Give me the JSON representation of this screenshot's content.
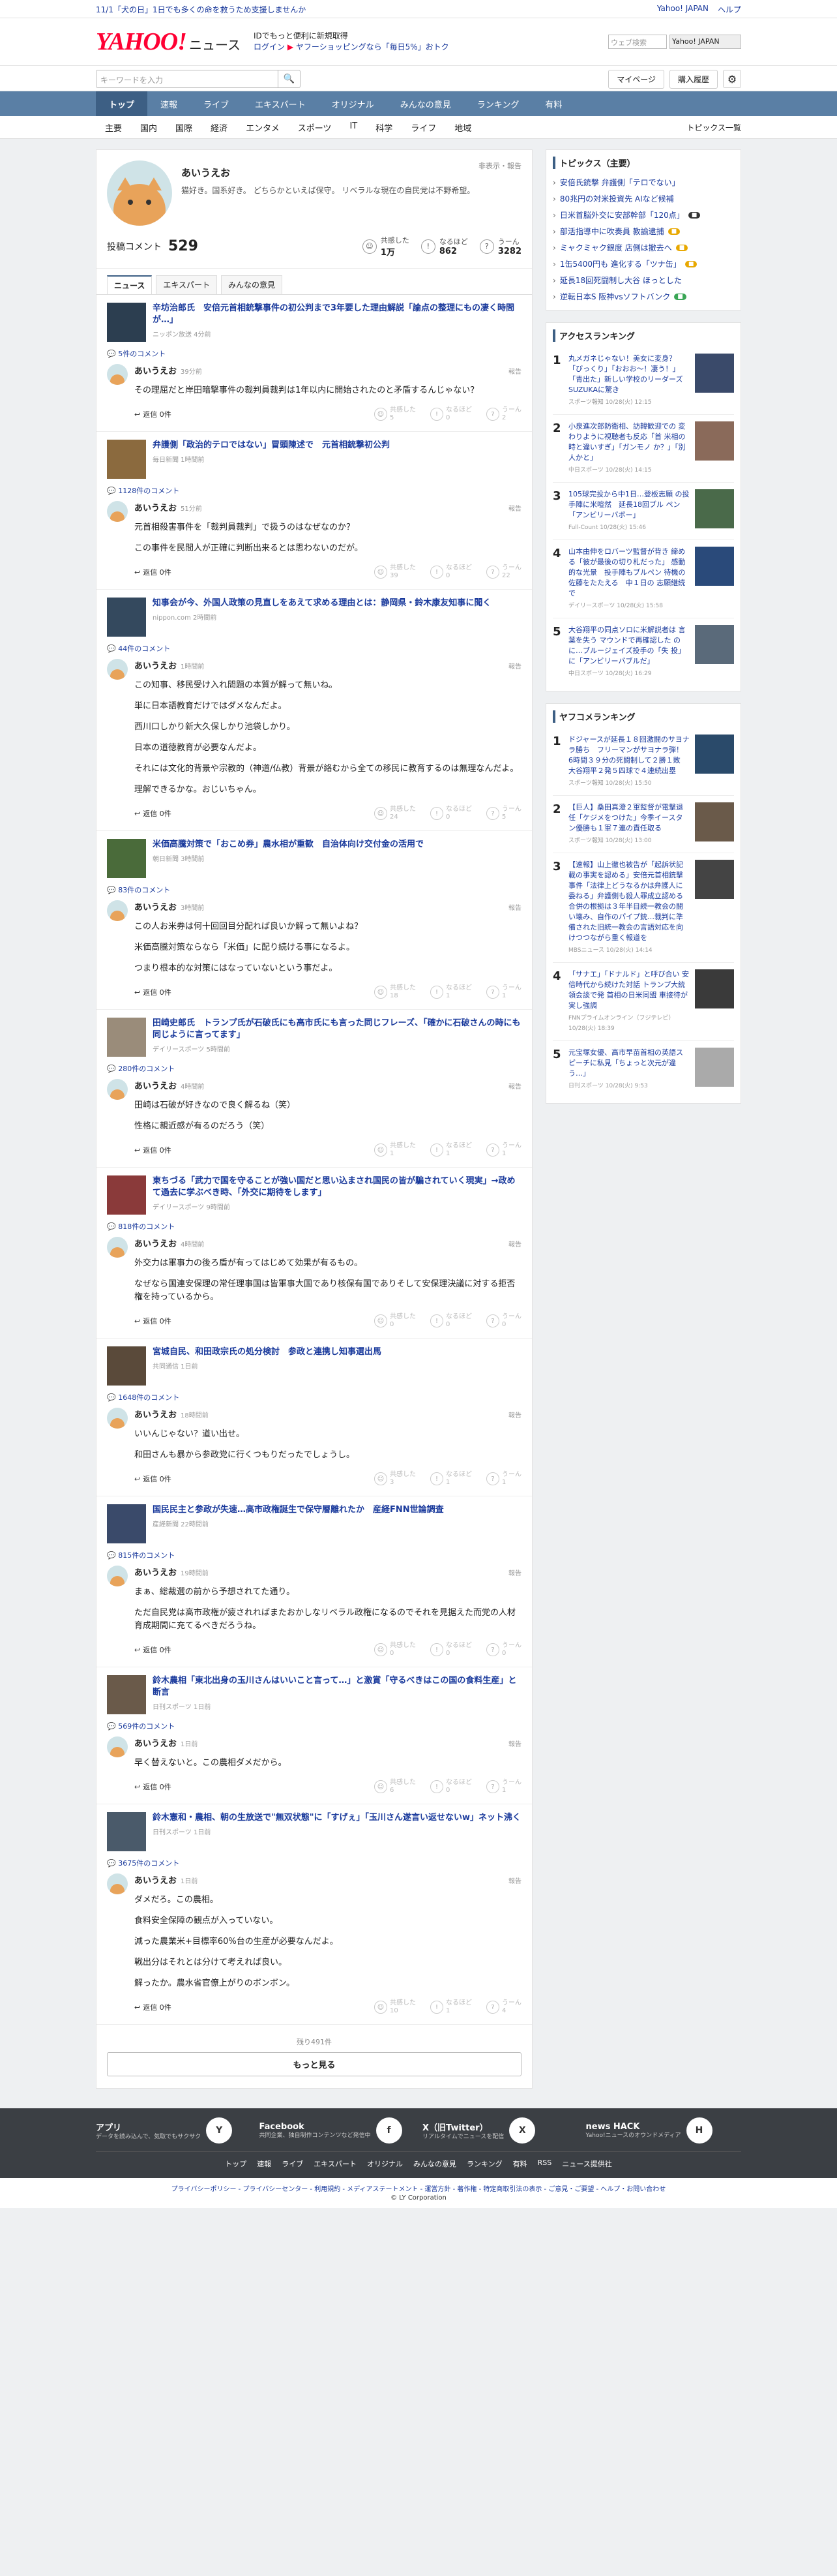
{
  "topbar": {
    "promo": "11/1「犬の日」1日でも多くの命を救うため支援しませんか",
    "links": [
      "Yahoo! JAPAN",
      "ヘルプ"
    ],
    "search_placeholder": "ウェブ検索",
    "yahoo_label": "Yahoo! JAPAN"
  },
  "header": {
    "logo": "YAHOO!",
    "logo_sub": "ニュース",
    "promo_line1": "IDでもっと便利に新規取得",
    "promo_login": "ログイン",
    "promo_line2": "ヤフーショッピングなら「毎日5%」おトク"
  },
  "searchbar": {
    "placeholder": "キーワードを入力",
    "mypage": "マイページ",
    "history": "購入履歴"
  },
  "nav1": [
    "トップ",
    "速報",
    "ライブ",
    "エキスパート",
    "オリジナル",
    "みんなの意見",
    "ランキング",
    "有料"
  ],
  "nav2": {
    "items": [
      "主要",
      "国内",
      "国際",
      "経済",
      "エンタメ",
      "スポーツ",
      "IT",
      "科学",
      "ライフ",
      "地域"
    ],
    "right": "トピックス一覧"
  },
  "profile": {
    "name": "あいうえお",
    "bio": "猫好き。国系好き。 どちらかといえば保守。 リベラルな現在の自民党は不野希望。",
    "report": "非表示・報告",
    "comment_label": "投稿コメント",
    "comment_count": "529",
    "reactions": [
      {
        "label": "共感した",
        "value": "1万"
      },
      {
        "label": "なるほど",
        "value": "862"
      },
      {
        "label": "うーん",
        "value": "3282"
      }
    ]
  },
  "tabs": [
    "ニュース",
    "エキスパート",
    "みんなの意見"
  ],
  "entries": [
    {
      "title": "辛坊治郎氏　安倍元首相銃撃事件の初公判まで3年要した理由解説「論点の整理にもの凄く時間が…」",
      "source": "ニッポン放送 4分前",
      "ccount": "5件のコメント",
      "time": "39分前",
      "paras": [
        "その理屈だと岸田暗撃事件の裁判員裁判は1年以内に開始されたのと矛盾するんじゃない？"
      ],
      "r": [
        "5",
        "0",
        "2"
      ]
    },
    {
      "title": "弁護側「政治的テロではない」冒頭陳述で　元首相銃撃初公判",
      "source": "毎日新聞 1時間前",
      "ccount": "1128件のコメント",
      "time": "51分前",
      "paras": [
        "元首相殺害事件を「裁判員裁判」で扱うのはなぜなのか？",
        "この事件を民間人が正確に判断出来るとは思わないのだが。"
      ],
      "r": [
        "39",
        "0",
        "22"
      ]
    },
    {
      "title": "知事会が今、外国人政策の見直しをあえて求める理由とは：静岡県・鈴木康友知事に聞く",
      "source": "nippon.com 2時間前",
      "ccount": "44件のコメント",
      "time": "1時間前",
      "paras": [
        "この知事、移民受け入れ問題の本質が解って無いね。",
        "単に日本語教育だけではダメなんだよ。",
        "西川口しかり新大久保しかり池袋しかり。",
        "日本の道徳教育が必要なんだよ。",
        "それには文化的背景や宗教的（神道/仏教）背景が絡むから全ての移民に教育するのは無理なんだよ。",
        "理解できるかな。おじいちゃん。"
      ],
      "r": [
        "24",
        "0",
        "5"
      ]
    },
    {
      "title": "米価高騰対策で「おこめ券」農水相が重歓　自治体向け交付金の活用で",
      "source": "朝日新聞 3時間前",
      "ccount": "83件のコメント",
      "time": "3時間前",
      "paras": [
        "この人お米券は何十回回目分配れば良いか解って無いよね？",
        "米価高騰対策ならなら「米価」に配り続ける事になるよ。",
        "つまり根本的な対策にはなっていないという事だよ。"
      ],
      "r": [
        "18",
        "1",
        "1"
      ]
    },
    {
      "title": "田崎史郎氏　トランプ氏が石破氏にも高市氏にも言った同じフレーズ、「確かに石破さんの時にも同じように言ってます」",
      "source": "デイリースポーツ 5時間前",
      "ccount": "280件のコメント",
      "time": "4時間前",
      "paras": [
        "田崎は石破が好きなので良く解るね（笑）",
        "性格に親近感が有るのだろう（笑）"
      ],
      "r": [
        "1",
        "1",
        "1"
      ]
    },
    {
      "title": "東ちづる「武力で国を守ることが強い国だと思い込まされ国民の皆が騙されていく現実」→政めて過去に学ぶべき時、「外交に期待をします」",
      "source": "デイリースポーツ 9時間前",
      "ccount": "818件のコメント",
      "time": "4時間前",
      "paras": [
        "外交力は軍事力の後ろ盾が有ってはじめて効果が有るもの。",
        "なぜなら国連安保理の常任理事国は皆軍事大国であり核保有国でありそして安保理決議に対する拒否権を持っているから。"
      ],
      "r": [
        "0",
        "0",
        "0"
      ]
    },
    {
      "title": "宮城自民、和田政宗氏の処分検討　参政と連携し知事選出馬",
      "source": "共同通信 1日前",
      "ccount": "1648件のコメント",
      "time": "18時間前",
      "paras": [
        "いいんじゃない？道い出せ。",
        "和田さんも暴から参政党に行くつもりだったでしょうし。"
      ],
      "r": [
        "3",
        "1",
        "1"
      ]
    },
    {
      "title": "国民民主と参政が失速…高市政権誕生で保守層離れたか　産経FNN世論調査",
      "source": "産経新聞 22時間前",
      "ccount": "815件のコメント",
      "time": "19時間前",
      "paras": [
        "まぁ、総裁選の前から予想されてた通り。",
        "ただ自民党は高市政権が疲されればまたおかしなリベラル政権になるのでそれを見据えた而党の人材育成期間に充てるべきだろうね。"
      ],
      "r": [
        "0",
        "0",
        "0"
      ]
    },
    {
      "title": "鈴木農相「東北出身の玉川さんはいいこと言って…」と激賞「守るべきはこの国の食料生産」と断言",
      "source": "日刊スポーツ 1日前",
      "ccount": "569件のコメント",
      "time": "1日前",
      "paras": [
        "早く替えないと。この農相ダメだから。"
      ],
      "r": [
        "6",
        "0",
        "1"
      ]
    },
    {
      "title": "鈴木憲和・農相、朝の生放送で\"無双状態\"に「すげぇ」「玉川さん遂言い返せないw」ネット沸く",
      "source": "日刊スポーツ 1日前",
      "ccount": "3675件のコメント",
      "time": "1日前",
      "paras": [
        "ダメだろ。この農相。",
        "食料安全保障の観点が入っていない。",
        "減った農業米+目標率60%台の生産が必要なんだよ。",
        "戦出分はそれとは分けて考えれば良い。",
        "解ったか。農水省官僚上がりのボンボン。"
      ],
      "r": [
        "10",
        "1",
        "4"
      ]
    }
  ],
  "comment_name": "あいうえお",
  "comment_report": "報告",
  "reply_label": "返信 0件",
  "react_labels": [
    "共感した",
    "なるほど",
    "うーん"
  ],
  "more": {
    "rest": "残り491件",
    "button": "もっと見る"
  },
  "topics": {
    "heading": "トピックス（主要）",
    "items": [
      {
        "t": "安倍氏銃撃 弁護側「テロでない」",
        "b": ""
      },
      {
        "t": "80兆円の対米投資先 AIなど候補",
        "b": ""
      },
      {
        "t": "日米首脳外交に安部幹部「120点」",
        "b": "icon"
      },
      {
        "t": "部活指導中に吹奏員 教諭逮捕",
        "b": "new"
      },
      {
        "t": "ミャクミャク銀度 店側は撤去へ",
        "b": "new"
      },
      {
        "t": "1缶5400円も 進化する「ツナ缶」",
        "b": "new"
      },
      {
        "t": "延長18回死闘制し大谷 ほっとした",
        "b": ""
      },
      {
        "t": "逆転日本S 阪神vsソフトバンク",
        "b": "live"
      }
    ],
    "badge_colors": {
      "new": "#e8a800",
      "live": "#3aa655",
      "icon": "#333333"
    }
  },
  "access": {
    "heading": "アクセスランキング",
    "items": [
      {
        "n": "1",
        "t": "丸メガネじゃない！美女に変身？「びっくり」「おおお～！凄う！」「青出た」新しい学校のリーダーズSUZUKAに驚き",
        "s": "スポーツ報知 10/28(火) 12:15"
      },
      {
        "n": "2",
        "t": "小泉進次郎防衛相、訪韓歓迎での 変わりように視聴者も反応「首 米相の時と違いすぎ」「ガンモノ か？」「別人かと」",
        "s": "中日スポーツ 10/28(火) 14:15"
      },
      {
        "n": "3",
        "t": "105球完投から中1日…登板志願 の投手陣に米喧然　延長18回ブル ペン「アンビリーバボー」",
        "s": "Full-Count 10/28(火) 15:46"
      },
      {
        "n": "4",
        "t": "山本由伸をロバーツ監督が背き 締める「彼が最後の切り札だった」 感動的な光景　投手陣もブルペン 待機の佐藤をたたえる　中１日の 志願継続で",
        "s": "デイリースポーツ 10/28(火) 15:58"
      },
      {
        "n": "5",
        "t": "大谷翔平の同点ソロに米解説者は 言葉を失う マウンドで再確認した のに…ブルージェイズ投手の「失 投」に「アンビリーバブルだ」",
        "s": "中日スポーツ 10/28(火) 16:29"
      }
    ]
  },
  "yafuko": {
    "heading": "ヤフコメランキング",
    "items": [
      {
        "n": "1",
        "t": "ドジャースが延長１８回激闘のサヨナラ勝ち　フリーマンがサヨナラ弾！　6時間３９分の死闘制して２勝１敗　大谷翔平２発５四球で４連続出塁",
        "s": "スポーツ報知 10/28(火) 15:50"
      },
      {
        "n": "2",
        "t": "【巨人】桑田真澄２軍監督が電撃退任「ケジメをつけた」今季イースタン優勝も１軍７連の責任取る",
        "s": "スポーツ報知 10/28(火) 13:00"
      },
      {
        "n": "3",
        "t": "【速報】山上徹也被告が「起訴状記載の事実を認める」安倍元首相銃撃事件「法律上どうなるかは弁護人に委ねる」弁護側も殺人罪成立認める　合併の根拠は３年半目続一教会の闘い壊み、自作のパイプ銃…裁判に準備された旧統一教会の言語対応を向けつつながら重く報道を",
        "s": "MBSニュース 10/28(火) 14:14"
      },
      {
        "n": "4",
        "t": "「サナエ」「ドナルド」と呼び合い 安倍時代から続けた対話 トランプ大統領会談で発 首相の日米同盟 車接待が実し強調",
        "s": "FNNプライムオンライン（フジテレビ）10/28(火) 18:39"
      },
      {
        "n": "5",
        "t": "元宝塚女優、高市早苗首相の英語スピーチに私見「ちょっと次元が違う…」",
        "s": "日刊スポーツ 10/28(火) 9:53"
      }
    ]
  },
  "footer": {
    "apps": [
      {
        "t": "アプリ",
        "d": "データを読み込んで、気取でもサクサク",
        "ic": "Y"
      },
      {
        "t": "Facebook",
        "d": "共同企業、独自制作コンテンツなど発信中",
        "ic": "f"
      },
      {
        "t": "X（旧Twitter）",
        "d": "リアルタイムでニュースを配信",
        "ic": "X"
      },
      {
        "t": "news HACK",
        "d": "Yahoo!ニュースのオウンドメディア",
        "ic": "H"
      }
    ],
    "links": [
      "トップ",
      "速報",
      "ライブ",
      "エキスパート",
      "オリジナル",
      "みんなの意見",
      "ランキング",
      "有料",
      "RSS",
      "ニュース提供社"
    ]
  },
  "legal": {
    "links": "プライバシーポリシー - プライバシーセンター - 利用規約 - メディアステートメント - 運営方針 - 著作権 - 特定商取引法の表示 - ご意見・ご要望 - ヘルプ・お問い合わせ",
    "copyright": "© LY Corporation"
  }
}
